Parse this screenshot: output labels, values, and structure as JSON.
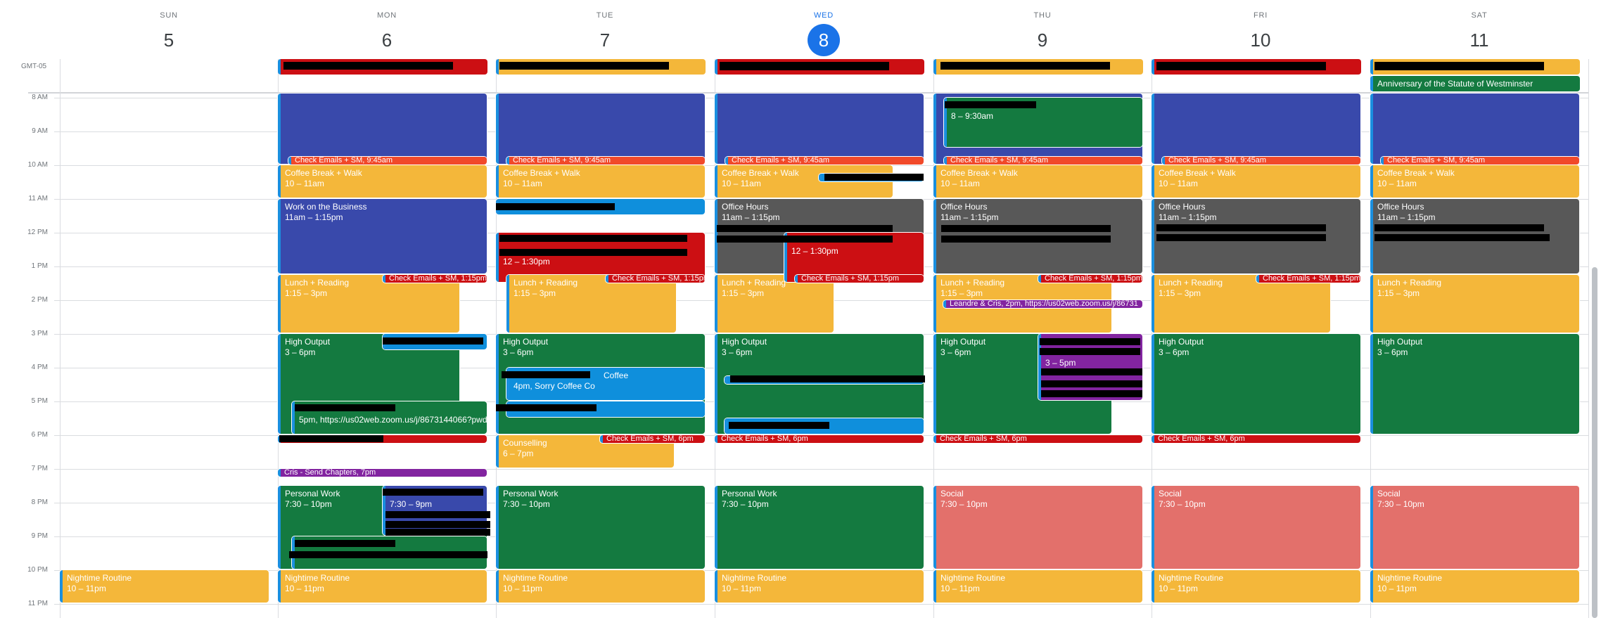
{
  "header": {
    "timezone": "GMT-05"
  },
  "time_labels": [
    "8 AM",
    "9 AM",
    "10 AM",
    "11 AM",
    "12 PM",
    "1 PM",
    "2 PM",
    "3 PM",
    "4 PM",
    "5 PM",
    "6 PM",
    "7 PM",
    "8 PM",
    "9 PM",
    "10 PM",
    "11 PM"
  ],
  "colors": {
    "blueberry": "#3949ab",
    "tangerine": "#f1492a",
    "banana": "#f4b73a",
    "basil": "#147a40",
    "graphite": "#585858",
    "tomato": "#cc0f13",
    "grape": "#8224a0",
    "peacock": "#0f8fdc",
    "flamingo": "#e3706b",
    "stripe": "#1a8fdf",
    "today": "#1a73e8"
  },
  "days": [
    {
      "name": "SUN",
      "date": "5",
      "today": false,
      "all_day": [],
      "events": [
        {
          "title": "Nightime Routine",
          "time": "10 – 11pm",
          "start": 22,
          "end": 23,
          "color": "banana"
        }
      ]
    },
    {
      "name": "MON",
      "date": "6",
      "today": false,
      "all_day": [
        {
          "title": "",
          "color": "tomato"
        }
      ],
      "events": [
        {
          "title": "",
          "time": "",
          "start": null,
          "end": 10,
          "color": "blueberry"
        },
        {
          "label": "Check Emails + SM, 9:45am",
          "start": 9.75,
          "end": 10,
          "color": "tangerine",
          "chip": true
        },
        {
          "title": "Coffee Break + Walk",
          "time": "10 – 11am",
          "start": 10,
          "end": 11,
          "color": "banana"
        },
        {
          "title": "Work on the Business",
          "time": "11am – 1:15pm",
          "start": 11,
          "end": 13.25,
          "color": "blueberry"
        },
        {
          "title": "Lunch + Reading",
          "time": "1:15 – 3pm",
          "start": 13.25,
          "end": 15,
          "color": "banana"
        },
        {
          "label": "Check Emails + SM, 1:15pm",
          "start": 13.25,
          "end": 13.5,
          "color": "tomato",
          "chip": true
        },
        {
          "title": "High Output",
          "time": "3 – 6pm",
          "start": 15,
          "end": 18,
          "color": "basil"
        },
        {
          "title": "",
          "time": "",
          "start": 15,
          "end": 15.5,
          "color": "peacock"
        },
        {
          "title": "",
          "time": "5pm, https://us02web.zoom.us/j/8673144066?pwd",
          "start": 17,
          "end": 18,
          "color": "basil"
        },
        {
          "label": "",
          "start": 18,
          "end": 18.25,
          "color": "tomato",
          "chip": true
        },
        {
          "label": "Cris - Send Chapters, 7pm",
          "start": 19,
          "end": 19.25,
          "color": "grape",
          "chip": true
        },
        {
          "title": "Personal Work",
          "time": "7:30 – 10pm",
          "start": 19.5,
          "end": 22,
          "color": "basil"
        },
        {
          "title": "",
          "time": "7:30 – 9pm",
          "start": 19.5,
          "end": 21,
          "color": "blueberry"
        },
        {
          "title": "",
          "time": "",
          "start": 21,
          "end": 22,
          "color": "basil"
        },
        {
          "title": "Nightime Routine",
          "time": "10 – 11pm",
          "start": 22,
          "end": 23,
          "color": "banana"
        }
      ]
    },
    {
      "name": "TUE",
      "date": "7",
      "today": false,
      "all_day": [
        {
          "title": "",
          "color": "banana"
        }
      ],
      "events": [
        {
          "title": "",
          "time": "",
          "start": null,
          "end": 10,
          "color": "blueberry"
        },
        {
          "label": "Check Emails + SM, 9:45am",
          "start": 9.75,
          "end": 10,
          "color": "tangerine",
          "chip": true
        },
        {
          "title": "Coffee Break + Walk",
          "time": "10 – 11am",
          "start": 10,
          "end": 11,
          "color": "banana"
        },
        {
          "title": "",
          "time": "",
          "start": 11,
          "end": 11.5,
          "color": "peacock"
        },
        {
          "title": "",
          "time": "12 – 1:30pm",
          "start": 12,
          "end": 13.5,
          "color": "tomato"
        },
        {
          "title": "Lunch + Reading",
          "time": "1:15 – 3pm",
          "start": 13.25,
          "end": 15,
          "color": "banana"
        },
        {
          "label": "Check Emails + SM, 1:15pm",
          "start": 13.25,
          "end": 13.5,
          "color": "tomato",
          "chip": true
        },
        {
          "title": "High Output",
          "time": "3 – 6pm",
          "start": 15,
          "end": 18,
          "color": "basil"
        },
        {
          "title": "Coffee",
          "time": "4pm, Sorry Coffee Co",
          "start": 16,
          "end": 17,
          "color": "peacock"
        },
        {
          "title": "",
          "time": "",
          "start": 17,
          "end": 17.5,
          "color": "peacock"
        },
        {
          "title": "Counselling",
          "time": "6 – 7pm",
          "start": 18,
          "end": 19,
          "color": "banana"
        },
        {
          "label": "Check Emails + SM, 6pm",
          "start": 18,
          "end": 18.25,
          "color": "tomato",
          "chip": true
        },
        {
          "title": "Personal Work",
          "time": "7:30 – 10pm",
          "start": 19.5,
          "end": 22,
          "color": "basil"
        },
        {
          "title": "Nightime Routine",
          "time": "10 – 11pm",
          "start": 22,
          "end": 23,
          "color": "banana"
        }
      ]
    },
    {
      "name": "WED",
      "date": "8",
      "today": true,
      "all_day": [
        {
          "title": "",
          "color": "tomato"
        }
      ],
      "events": [
        {
          "title": "",
          "time": "",
          "start": null,
          "end": 10,
          "color": "blueberry"
        },
        {
          "label": "Check Emails + SM, 9:45am",
          "start": 9.75,
          "end": 10,
          "color": "tangerine",
          "chip": true
        },
        {
          "title": "Coffee Break + Walk",
          "time": "10 – 11am",
          "start": 10,
          "end": 11,
          "color": "banana"
        },
        {
          "label": "",
          "start": 10.25,
          "end": 10.5,
          "color": "peacock",
          "chip": true
        },
        {
          "title": "Office Hours",
          "time": "11am – 1:15pm",
          "start": 11,
          "end": 13.25,
          "color": "graphite"
        },
        {
          "title": "Lunch + Reading",
          "time": "1:15 – 3pm",
          "start": 13.25,
          "end": 15,
          "color": "banana"
        },
        {
          "title": "",
          "time": "12 – 1:30pm",
          "start": 12,
          "end": 13.5,
          "color": "tomato"
        },
        {
          "label": "Check Emails + SM, 1:15pm",
          "start": 13.25,
          "end": 13.5,
          "color": "tomato",
          "chip": true
        },
        {
          "title": "High Output",
          "time": "3 – 6pm",
          "start": 15,
          "end": 18,
          "color": "basil"
        },
        {
          "label": "",
          "start": 16.25,
          "end": 16.5,
          "color": "peacock",
          "chip": true
        },
        {
          "title": "",
          "time": "",
          "start": 17.5,
          "end": 18,
          "color": "peacock"
        },
        {
          "label": "Check Emails + SM, 6pm",
          "start": 18,
          "end": 18.25,
          "color": "tomato",
          "chip": true
        },
        {
          "title": "Personal Work",
          "time": "7:30 – 10pm",
          "start": 19.5,
          "end": 22,
          "color": "basil"
        },
        {
          "title": "Nightime Routine",
          "time": "10 – 11pm",
          "start": 22,
          "end": 23,
          "color": "banana"
        }
      ]
    },
    {
      "name": "THU",
      "date": "9",
      "today": false,
      "all_day": [
        {
          "title": "",
          "color": "banana"
        }
      ],
      "events": [
        {
          "title": "",
          "time": "",
          "start": null,
          "end": 10,
          "color": "blueberry"
        },
        {
          "title": "",
          "time": "8 – 9:30am",
          "start": 8,
          "end": 9.5,
          "color": "basil"
        },
        {
          "label": "Check Emails + SM, 9:45am",
          "start": 9.75,
          "end": 10,
          "color": "tangerine",
          "chip": true
        },
        {
          "title": "Coffee Break + Walk",
          "time": "10 – 11am",
          "start": 10,
          "end": 11,
          "color": "banana"
        },
        {
          "title": "Office Hours",
          "time": "11am – 1:15pm",
          "start": 11,
          "end": 13.25,
          "color": "graphite"
        },
        {
          "title": "Lunch + Reading",
          "time": "1:15 – 3pm",
          "start": 13.25,
          "end": 15,
          "color": "banana"
        },
        {
          "label": "Check Emails + SM, 1:15pm",
          "start": 13.25,
          "end": 13.5,
          "color": "tomato",
          "chip": true
        },
        {
          "label": "Leandre & Cris, 2pm, https://us02web.zoom.us/j/86731",
          "start": 14,
          "end": 14.25,
          "color": "grape",
          "chip": true
        },
        {
          "title": "High Output",
          "time": "3 – 6pm",
          "start": 15,
          "end": 18,
          "color": "basil"
        },
        {
          "title": "",
          "time": "3 – 5pm",
          "start": 15,
          "end": 17,
          "color": "grape"
        },
        {
          "label": "Check Emails + SM, 6pm",
          "start": 18,
          "end": 18.25,
          "color": "tomato",
          "chip": true
        },
        {
          "title": "Social",
          "time": "7:30 – 10pm",
          "start": 19.5,
          "end": 22,
          "color": "flamingo"
        },
        {
          "title": "Nightime Routine",
          "time": "10 – 11pm",
          "start": 22,
          "end": 23,
          "color": "banana"
        }
      ]
    },
    {
      "name": "FRI",
      "date": "10",
      "today": false,
      "all_day": [
        {
          "title": "",
          "color": "tomato"
        }
      ],
      "events": [
        {
          "title": "",
          "time": "",
          "start": null,
          "end": 10,
          "color": "blueberry"
        },
        {
          "label": "Check Emails + SM, 9:45am",
          "start": 9.75,
          "end": 10,
          "color": "tangerine",
          "chip": true
        },
        {
          "title": "Coffee Break + Walk",
          "time": "10 – 11am",
          "start": 10,
          "end": 11,
          "color": "banana"
        },
        {
          "title": "Office Hours",
          "time": "11am – 1:15pm",
          "start": 11,
          "end": 13.25,
          "color": "graphite"
        },
        {
          "title": "Lunch + Reading",
          "time": "1:15 – 3pm",
          "start": 13.25,
          "end": 15,
          "color": "banana"
        },
        {
          "label": "Check Emails + SM, 1:15pm",
          "start": 13.25,
          "end": 13.5,
          "color": "tomato",
          "chip": true
        },
        {
          "title": "High Output",
          "time": "3 – 6pm",
          "start": 15,
          "end": 18,
          "color": "basil"
        },
        {
          "label": "Check Emails + SM, 6pm",
          "start": 18,
          "end": 18.25,
          "color": "tomato",
          "chip": true
        },
        {
          "title": "Social",
          "time": "7:30 – 10pm",
          "start": 19.5,
          "end": 22,
          "color": "flamingo"
        },
        {
          "title": "Nightime Routine",
          "time": "10 – 11pm",
          "start": 22,
          "end": 23,
          "color": "banana"
        }
      ]
    },
    {
      "name": "SAT",
      "date": "11",
      "today": false,
      "all_day": [
        {
          "title": "",
          "color": "banana"
        },
        {
          "title": "Anniversary of the Statute of Westminster",
          "color": "basil"
        }
      ],
      "events": [
        {
          "title": "",
          "time": "",
          "start": null,
          "end": 10,
          "color": "blueberry"
        },
        {
          "label": "Check Emails + SM, 9:45am",
          "start": 9.75,
          "end": 10,
          "color": "tangerine",
          "chip": true
        },
        {
          "title": "Coffee Break + Walk",
          "time": "10 – 11am",
          "start": 10,
          "end": 11,
          "color": "banana"
        },
        {
          "title": "Office Hours",
          "time": "11am – 1:15pm",
          "start": 11,
          "end": 13.25,
          "color": "graphite"
        },
        {
          "title": "Lunch + Reading",
          "time": "1:15 – 3pm",
          "start": 13.25,
          "end": 15,
          "color": "banana"
        },
        {
          "title": "High Output",
          "time": "3 – 6pm",
          "start": 15,
          "end": 18,
          "color": "basil"
        },
        {
          "title": "Social",
          "time": "7:30 – 10pm",
          "start": 19.5,
          "end": 22,
          "color": "flamingo"
        },
        {
          "title": "Nightime Routine",
          "time": "10 – 11pm",
          "start": 22,
          "end": 23,
          "color": "banana"
        }
      ]
    }
  ]
}
